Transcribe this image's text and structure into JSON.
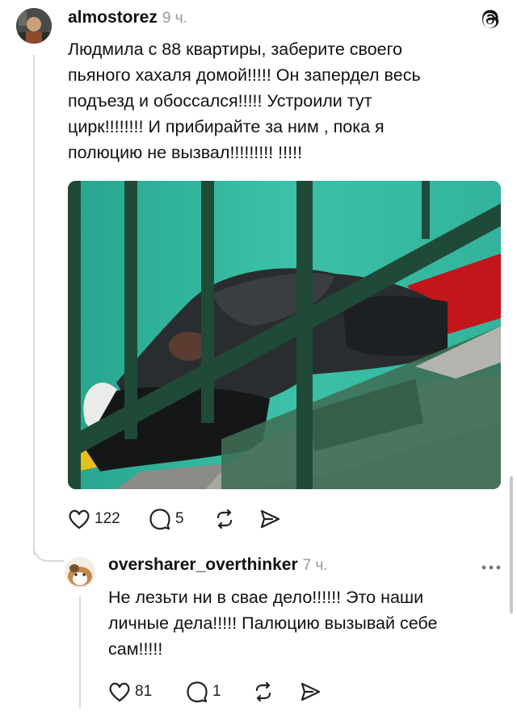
{
  "post": {
    "username": "almostorez",
    "time": "9 ч.",
    "text_lines": [
      "Людмила с 88 квартиры, заберите своего",
      "пьяного хахаля домой!!!!! Он запердел весь",
      "подъезд и обоссался!!!!! Устроили тут",
      "цирк!!!!!!!! И прибирайте за ним , пока я",
      "полюцию не вызвал!!!!!!!!! !!!!!"
    ],
    "likes": "122",
    "replies": "5",
    "icons": [
      "threads-logo-icon",
      "heart-icon",
      "comment-icon",
      "repost-icon",
      "share-icon"
    ]
  },
  "reply": {
    "username": "oversharer_overthinker",
    "time": "7 ч.",
    "text_lines": [
      "Не лезьти ни в свае дело!!!!!! Это наши",
      "личные дела!!!!! Палюцию вызывай себе",
      "сам!!!!!"
    ],
    "likes": "81",
    "replies": "1",
    "icons": [
      "more-icon",
      "heart-icon",
      "comment-icon",
      "repost-icon",
      "share-icon"
    ]
  },
  "colors": {
    "wall": "#2fb39b",
    "railing": "#1f4a38",
    "floor": "#c2161b",
    "stairs": "#3d6e55",
    "text": "#111111",
    "muted": "#9a9a9a"
  }
}
